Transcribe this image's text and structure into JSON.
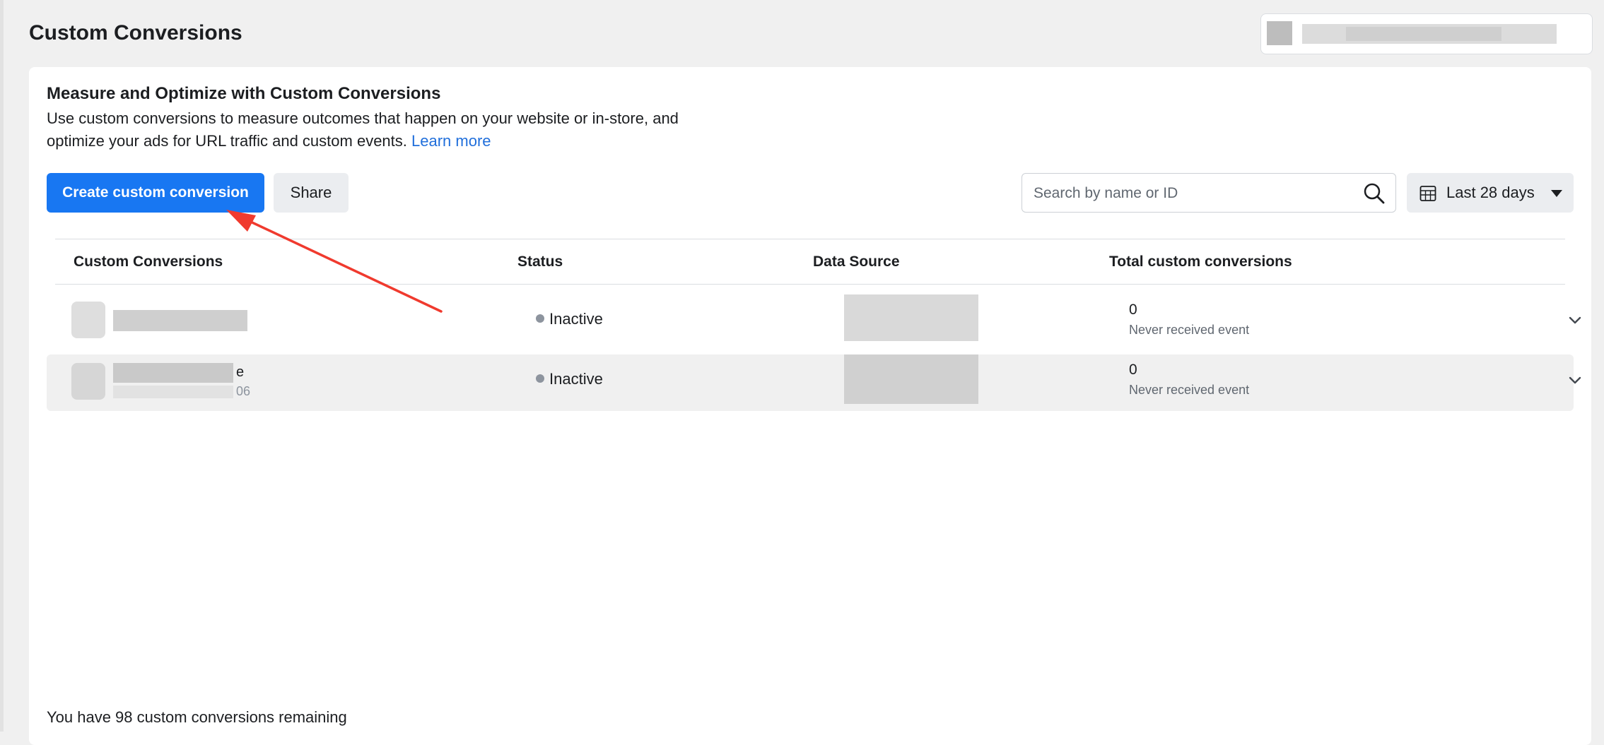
{
  "header": {
    "title": "Custom Conversions"
  },
  "intro": {
    "title": "Measure and Optimize with Custom Conversions",
    "text": "Use custom conversions to measure outcomes that happen on your website or in-store, and optimize your ads for URL traffic and custom events.",
    "learn_more": "Learn more"
  },
  "toolbar": {
    "create_label": "Create custom conversion",
    "share_label": "Share",
    "search_placeholder": "Search by name or ID",
    "date_range": "Last 28 days",
    "search_icon": "search-icon",
    "calendar_icon": "calendar-icon"
  },
  "table": {
    "columns": [
      "Custom Conversions",
      "Status",
      "Data Source",
      "Total custom conversions"
    ],
    "rows": [
      {
        "status": "Inactive",
        "total": "0",
        "total_note": "Never received event"
      },
      {
        "name_fragment": "e",
        "id_fragment": "06",
        "status": "Inactive",
        "total": "0",
        "total_note": "Never received event"
      }
    ]
  },
  "footer": {
    "remaining": "You have 98 custom conversions remaining"
  },
  "colors": {
    "accent": "#1877f2",
    "link": "#216fdb",
    "annotation_arrow": "#f03a2e"
  }
}
